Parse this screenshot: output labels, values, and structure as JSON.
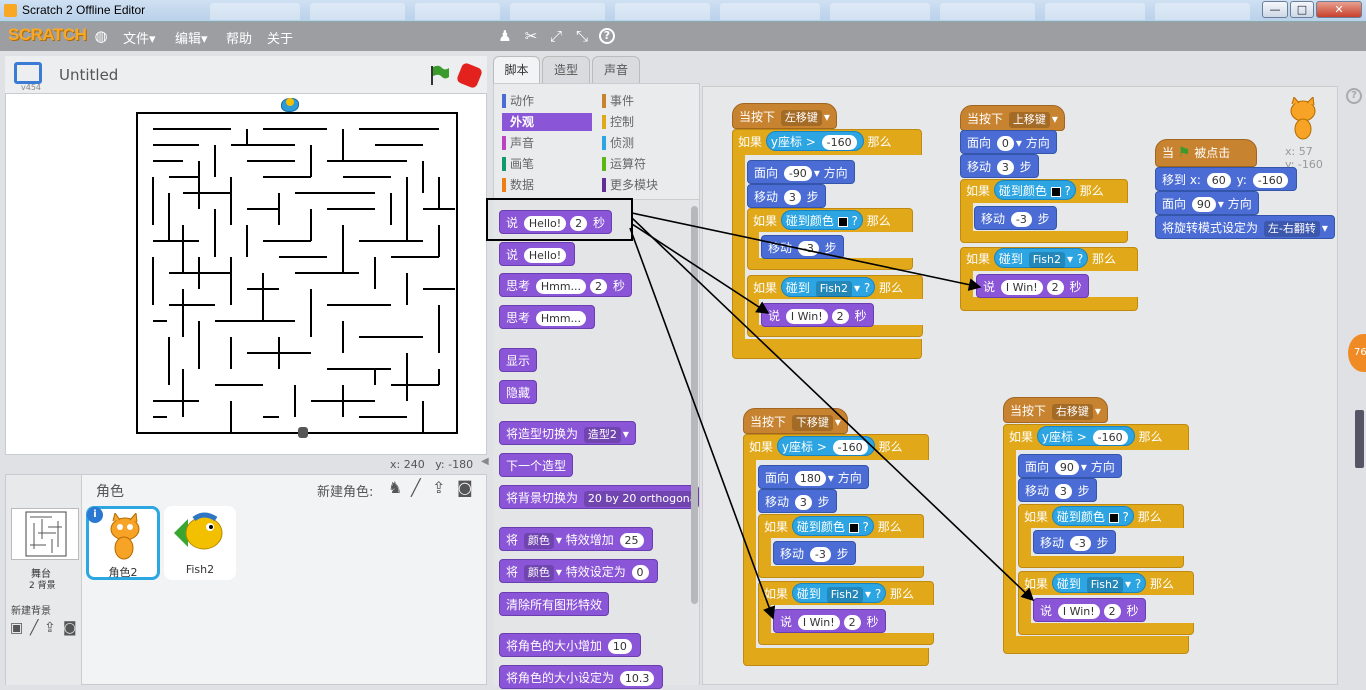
{
  "window": {
    "title": "Scratch 2 Offline Editor",
    "controls": {
      "minimize": "—",
      "maximize": "□",
      "close": "✕"
    }
  },
  "menubar": {
    "logo": "SCRATCH",
    "file": "文件▾",
    "edit": "编辑▾",
    "help": "帮助",
    "about": "关于"
  },
  "stage": {
    "version": "v454",
    "project_title": "Untitled",
    "coords": {
      "x_label": "x:",
      "x": "240",
      "y_label": "y:",
      "y": "-180"
    }
  },
  "sprites": {
    "header": "角色",
    "new_sprite_label": "新建角色:",
    "stage_label": "舞台",
    "stage_backdrops": "2 背景",
    "new_backdrop": "新建背景",
    "items": [
      {
        "name": "角色2",
        "selected": true
      },
      {
        "name": "Fish2",
        "selected": false
      }
    ]
  },
  "tabs": [
    "脚本",
    "造型",
    "声音"
  ],
  "categories": {
    "left": [
      {
        "label": "动作",
        "color": "#4a6cd4"
      },
      {
        "label": "外观",
        "color": "#8a55d7",
        "selected": true
      },
      {
        "label": "声音",
        "color": "#bb42c3"
      },
      {
        "label": "画笔",
        "color": "#0e9a6c"
      },
      {
        "label": "数据",
        "color": "#ee7d16"
      }
    ],
    "right": [
      {
        "label": "事件",
        "color": "#c88330"
      },
      {
        "label": "控制",
        "color": "#e1a91a"
      },
      {
        "label": "侦测",
        "color": "#2ca5e2"
      },
      {
        "label": "运算符",
        "color": "#5cb712"
      },
      {
        "label": "更多模块",
        "color": "#632d99"
      }
    ]
  },
  "palette": {
    "say_secs": {
      "a": "说",
      "v1": "Hello!",
      "v2": "2",
      "b": "秒"
    },
    "say": {
      "a": "说",
      "v1": "Hello!"
    },
    "think_secs": {
      "a": "思考",
      "v1": "Hmm...",
      "v2": "2",
      "b": "秒"
    },
    "think": {
      "a": "思考",
      "v1": "Hmm..."
    },
    "show": "显示",
    "hide": "隐藏",
    "switch_costume": {
      "a": "将造型切换为",
      "v": "造型2"
    },
    "next_costume": "下一个造型",
    "switch_backdrop": {
      "a": "将背景切换为",
      "v": "20 by 20 orthogona"
    },
    "change_effect": {
      "a": "将",
      "v1": "颜色",
      "b": "特效增加",
      "v2": "25"
    },
    "set_effect": {
      "a": "将",
      "v1": "颜色",
      "b": "特效设定为",
      "v2": "0"
    },
    "clear_effects": "清除所有图形特效",
    "change_size": {
      "a": "将角色的大小增加",
      "v": "10"
    },
    "set_size": {
      "a": "将角色的大小设定为",
      "v": "10.3"
    }
  },
  "scripts": {
    "when_key": "当按下",
    "left_key": "左移键",
    "up_key": "上移键",
    "down_key": "下移键",
    "right_key": "右移键",
    "if": "如果",
    "then": "那么",
    "y_pos": "y座标",
    "gt": ">",
    "neg160": "-160",
    "point_dir": "面向",
    "dir_word": "方向",
    "move": "移动",
    "steps": "步",
    "touch_color": "碰到颜色",
    "touch": "碰到",
    "qmark": "?",
    "fish2": "Fish2",
    "say": "说",
    "iwin": "I Win!",
    "two": "2",
    "secs": "秒",
    "dir_neg90": "-90",
    "dir_0": "0",
    "dir_180": "180",
    "dir_90": "90",
    "three": "3",
    "neg3": "-3",
    "flag_when": "当",
    "flag_clicked": "被点击",
    "goto": "移到 x:",
    "goto_x": "60",
    "goto_y_label": "y:",
    "goto_y": "-160",
    "rot_style": "将旋转模式设定为",
    "rot_value": "左-右翻转"
  },
  "sprite_info": {
    "x_label": "x:",
    "x": "57",
    "y_label": "y:",
    "y": "-160"
  },
  "side_badge": "76"
}
